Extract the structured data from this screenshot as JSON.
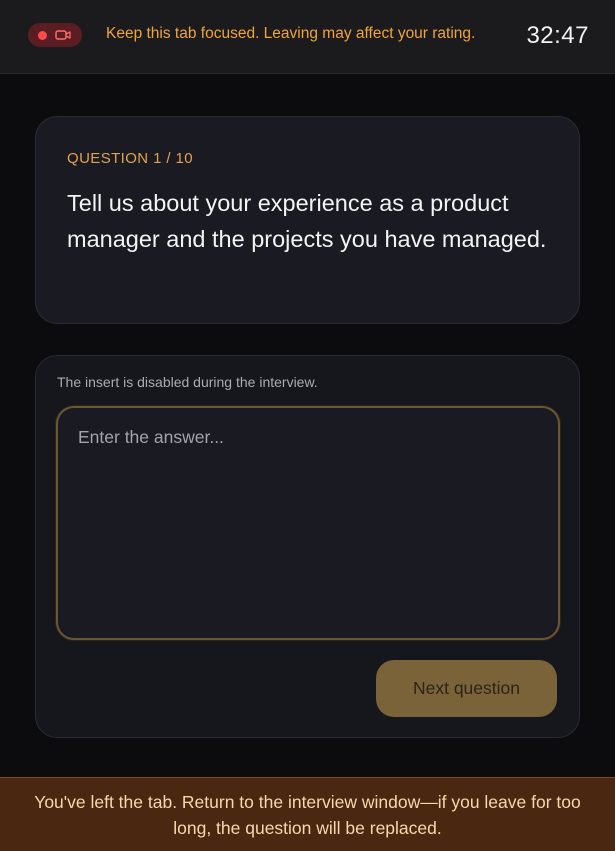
{
  "topbar": {
    "recording_icons": [
      "record-dot-icon",
      "camera-icon"
    ],
    "focus_note": "Keep this tab focused. Leaving may affect your rating.",
    "timer": "32:47"
  },
  "question": {
    "counter": "QUESTION 1 / 10",
    "text": "Tell us about your experience as a product manager and the projects you have managed."
  },
  "answer": {
    "insert_note": "The insert is disabled during the interview.",
    "placeholder": "Enter the answer...",
    "value": "",
    "next_label": "Next question"
  },
  "warning": {
    "text": "You've left the tab. Return to the interview window—if you leave for too long, the question will be replaced."
  },
  "colors": {
    "accent": "#e0a24f",
    "record": "#ff4a4a",
    "button": "#7a6339",
    "warning_bg": "#4a2710"
  }
}
